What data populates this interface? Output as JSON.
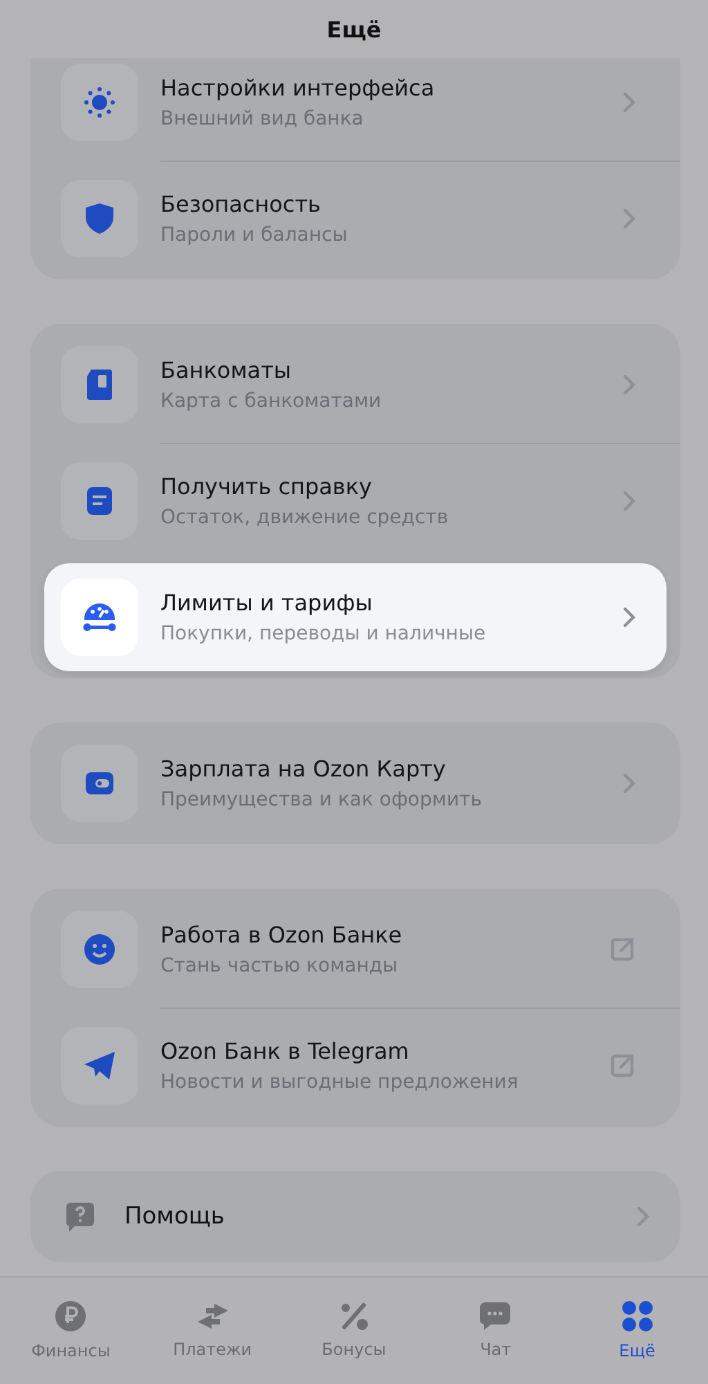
{
  "header": {
    "title": "Ещё"
  },
  "groups": [
    {
      "items": [
        {
          "title": "Настройки интерфейса",
          "subtitle": "Внешний вид банка",
          "kind": "chevron",
          "highlighted": false
        },
        {
          "title": "Безопасность",
          "subtitle": "Пароли и балансы",
          "kind": "chevron",
          "highlighted": false
        }
      ]
    },
    {
      "items": [
        {
          "title": "Банкоматы",
          "subtitle": "Карта с банкоматами",
          "kind": "chevron",
          "highlighted": false
        },
        {
          "title": "Получить справку",
          "subtitle": "Остаток, движение средств",
          "kind": "chevron",
          "highlighted": false
        },
        {
          "title": "Лимиты и тарифы",
          "subtitle": "Покупки, переводы и наличные",
          "kind": "chevron",
          "highlighted": true
        }
      ]
    },
    {
      "items": [
        {
          "title": "Зарплата на Ozon Карту",
          "subtitle": "Преимущества и как оформить",
          "kind": "chevron",
          "highlighted": false
        }
      ]
    },
    {
      "items": [
        {
          "title": "Работа в Ozon Банке",
          "subtitle": "Стань частью команды",
          "kind": "external",
          "highlighted": false
        },
        {
          "title": "Ozon Банк в Telegram",
          "subtitle": "Новости и выгодные предложения",
          "kind": "external",
          "highlighted": false
        }
      ]
    }
  ],
  "help": {
    "title": "Помощь"
  },
  "tabs": [
    {
      "label": "Финансы",
      "selected": false
    },
    {
      "label": "Платежи",
      "selected": false
    },
    {
      "label": "Бонусы",
      "selected": false
    },
    {
      "label": "Чат",
      "selected": false
    },
    {
      "label": "Ещё",
      "selected": true
    }
  ]
}
